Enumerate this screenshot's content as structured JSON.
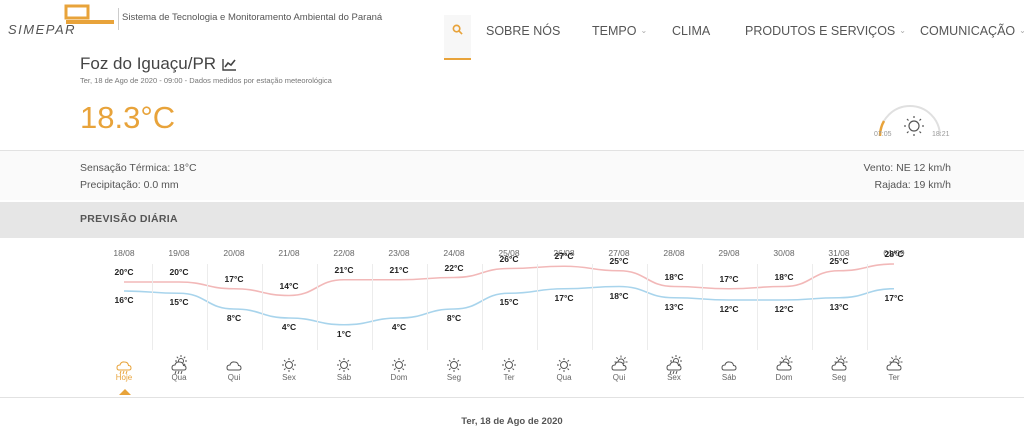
{
  "header": {
    "brand": "SIMEPAR",
    "subtitle": "Sistema de Tecnologia e Monitoramento Ambiental do Paraná",
    "nav": [
      {
        "label": "SOBRE NÓS",
        "dropdown": false
      },
      {
        "label": "TEMPO",
        "dropdown": true
      },
      {
        "label": "CLIMA",
        "dropdown": false
      },
      {
        "label": "PRODUTOS E SERVIÇOS",
        "dropdown": true
      },
      {
        "label": "COMUNICAÇÃO",
        "dropdown": true
      }
    ]
  },
  "location": {
    "city": "Foz do Iguaçu/PR",
    "subline": "Ter, 18 de Ago de 2020 - 09:00 - Dados medidos por estação meteorológica",
    "temperature": "18.3°C",
    "sunrise": "07:05",
    "sunset": "18:21"
  },
  "details": {
    "sensacao": "Sensação Térmica: 18°C",
    "precipitacao": "Precipitação: 0.0 mm",
    "vento": "Vento: NE 12 km/h",
    "rajada": "Rajada: 19 km/h"
  },
  "forecast": {
    "title": "PREVISÃO DIÁRIA",
    "days": [
      {
        "date": "18/08",
        "day": "Hoje",
        "max": "20°C",
        "min": "16°C",
        "icon": "rain-icon"
      },
      {
        "date": "19/08",
        "day": "Qua",
        "max": "20°C",
        "min": "15°C",
        "icon": "sun-rain-icon"
      },
      {
        "date": "20/08",
        "day": "Qui",
        "max": "17°C",
        "min": "8°C",
        "icon": "cloud-icon"
      },
      {
        "date": "21/08",
        "day": "Sex",
        "max": "14°C",
        "min": "4°C",
        "icon": "sun-icon"
      },
      {
        "date": "22/08",
        "day": "Sáb",
        "max": "21°C",
        "min": "1°C",
        "icon": "sun-icon"
      },
      {
        "date": "23/08",
        "day": "Dom",
        "max": "21°C",
        "min": "4°C",
        "icon": "sun-icon"
      },
      {
        "date": "24/08",
        "day": "Seg",
        "max": "22°C",
        "min": "8°C",
        "icon": "sun-icon"
      },
      {
        "date": "25/08",
        "day": "Ter",
        "max": "26°C",
        "min": "15°C",
        "icon": "sun-icon"
      },
      {
        "date": "26/08",
        "day": "Qua",
        "max": "27°C",
        "min": "17°C",
        "icon": "sun-icon"
      },
      {
        "date": "27/08",
        "day": "Qui",
        "max": "25°C",
        "min": "18°C",
        "icon": "sun-cloud-icon"
      },
      {
        "date": "28/08",
        "day": "Sex",
        "max": "18°C",
        "min": "13°C",
        "icon": "sun-rain-icon"
      },
      {
        "date": "29/08",
        "day": "Sáb",
        "max": "17°C",
        "min": "12°C",
        "icon": "cloud-icon"
      },
      {
        "date": "30/08",
        "day": "Dom",
        "max": "18°C",
        "min": "12°C",
        "icon": "sun-cloud-icon"
      },
      {
        "date": "31/08",
        "day": "Seg",
        "max": "25°C",
        "min": "13°C",
        "icon": "sun-cloud-icon"
      },
      {
        "date": "01/09",
        "day": "Ter",
        "max": "28°C",
        "min": "17°C",
        "icon": "sun-cloud-icon"
      }
    ],
    "selected_date": "Ter, 18 de Ago de 2020"
  },
  "colors": {
    "accent": "#e8a33a",
    "max_line": "#f2b8b8",
    "min_line": "#a8d4ec"
  }
}
